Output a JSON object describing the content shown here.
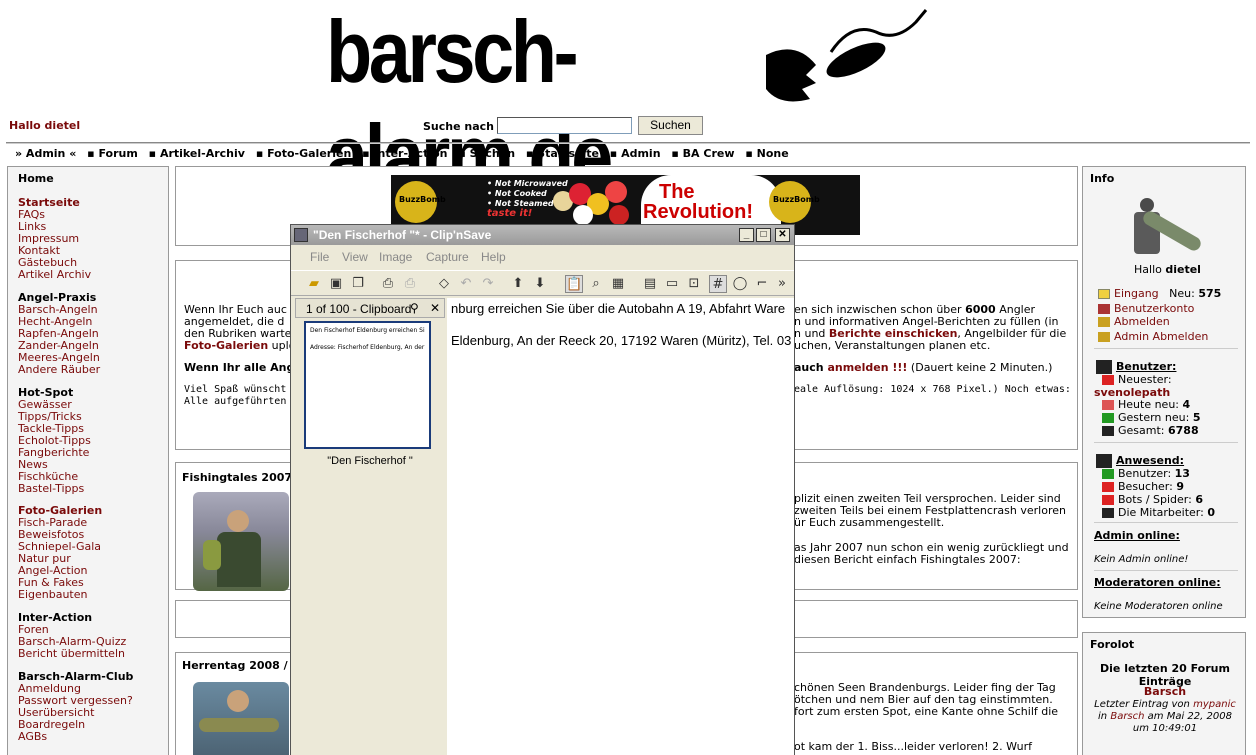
{
  "site": {
    "logo_text": "barsch-alarm.de",
    "greeting": "Hallo dietel"
  },
  "search": {
    "label": "Suche nach :",
    "value": "",
    "button": "Suchen"
  },
  "nav": [
    "» Admin «",
    "▪ Forum",
    "▪ Artikel-Archiv",
    "▪ Foto-Galerien",
    "▪ Inter-Action",
    "▪ Suchen",
    "▪ Startseite",
    "▪ Admin",
    "▪ BA Crew",
    "▪ None"
  ],
  "left": {
    "home": "Home",
    "groups": [
      {
        "items": [
          {
            "l": "Startseite",
            "b": true
          },
          {
            "l": "FAQs"
          },
          {
            "l": "Links"
          },
          {
            "l": "Impressum"
          },
          {
            "l": "Kontakt"
          },
          {
            "l": "Gästebuch"
          },
          {
            "l": "Artikel Archiv"
          }
        ]
      },
      {
        "header": "Angel-Praxis",
        "items": [
          {
            "l": "Barsch-Angeln"
          },
          {
            "l": "Hecht-Angeln"
          },
          {
            "l": "Rapfen-Angeln"
          },
          {
            "l": "Zander-Angeln"
          },
          {
            "l": "Meeres-Angeln"
          },
          {
            "l": "Andere Räuber"
          }
        ]
      },
      {
        "header": "Hot-Spot",
        "items": [
          {
            "l": "Gewässer"
          },
          {
            "l": "Tipps/Tricks"
          },
          {
            "l": "Tackle-Tipps"
          },
          {
            "l": "Echolot-Tipps"
          },
          {
            "l": "Fangberichte"
          },
          {
            "l": "News"
          },
          {
            "l": "Fischküche"
          },
          {
            "l": "Bastel-Tipps"
          }
        ]
      },
      {
        "items": [
          {
            "l": "Foto-Galerien",
            "b": true
          },
          {
            "l": "Fisch-Parade"
          },
          {
            "l": "Beweisfotos"
          },
          {
            "l": "Schniepel-Gala"
          },
          {
            "l": "Natur pur"
          },
          {
            "l": "Angel-Action"
          },
          {
            "l": "Fun & Fakes"
          },
          {
            "l": "Eigenbauten"
          }
        ]
      },
      {
        "header": "Inter-Action",
        "items": [
          {
            "l": "Foren"
          },
          {
            "l": "Barsch-Alarm-Quizz"
          },
          {
            "l": "Bericht übermitteln"
          }
        ]
      },
      {
        "header": "Barsch-Alarm-Club",
        "items": [
          {
            "l": "Anmeldung"
          },
          {
            "l": "Passwort vergessen?"
          },
          {
            "l": "Userübersicht"
          },
          {
            "l": "Boardregeln"
          },
          {
            "l": "AGBs"
          }
        ]
      }
    ]
  },
  "banner": {
    "lines": [
      "• Not Microwaved",
      "• Not Cooked",
      "• Not Steamed",
      "taste it!"
    ],
    "headline1": "The",
    "headline2": "Revolution!",
    "brand": "BuzzBomb"
  },
  "main1": {
    "l1a": "Wenn Ihr Euch auc",
    "l1b": "en sich inzwischen schon über ",
    "l1bold": "6000",
    "l1c": " Angler",
    "l2a": "angemeldet, die d",
    "l2b": "n und informativen Angel-Berichten zu füllen (in",
    "l3a": "den Rubriken warte",
    "l3b": "n und ",
    "l3link": "Berichte einschicken",
    "l3c": ", Angelbilder für die",
    "l4a": "Foto-Galerien",
    "l4b": " uplo",
    "l4c": "uchen, Veranstaltungen planen etc.",
    "l5a": "Wenn Ihr alle Ang",
    "l5b": "auch ",
    "l5link": "anmelden !!!",
    "l5c": " (Dauert keine 2 Minuten.)",
    "l6a": "Viel Spaß wünscht E",
    "l6b": "eale Auflösung: 1024 x 768 Pixel.) Noch etwas:",
    "l7a": "Alle aufgeführten P"
  },
  "main2": {
    "title": "Fishingtales 2007",
    "l1": "plizit einen zweiten Teil versprochen. Leider sind",
    "l2": "zweiten Teils bei einem Festplattencrash verloren",
    "l3": "ür Euch zusammengestellt.",
    "l4": "as Jahr 2007 nun schon ein wenig zurückliegt und",
    "l5": "diesen Bericht einfach Fishingtales 2007:"
  },
  "main4": {
    "title": "Herrentag 2008 / 1",
    "l1": "chönen Seen Brandenburgs. Leider fing der Tag",
    "l2": "ötchen und nem Bier auf den tag einstimmten.",
    "l3": "fort zum ersten Spot, eine Kante ohne Schilf die",
    "l4": "ot kam der 1. Biss...leider verloren! 2. Wurf"
  },
  "window": {
    "title": "\"Den Fischerhof \"* - Clip'nSave",
    "menu": [
      "File",
      "View",
      "Image",
      "Capture",
      "Help"
    ],
    "pane_title": "1 of 100 - Clipboard",
    "thumb_l1": "Den Fischerhof Eldenburg erreichen Si",
    "thumb_l2": "Adresse: Fischerhof Eldenburg, An der",
    "thumb_caption": "\"Den Fischerhof \"",
    "canvas_l1": "nburg erreichen Sie über die Autobahn A 19, Abfahrt Ware",
    "canvas_l2": "Eldenburg, An der Reeck 20, 17192 Waren (Müritz), Tel. 03"
  },
  "right": {
    "info": "Info",
    "hallo": "Hallo",
    "user": "dietel",
    "eingang": "Eingang",
    "neu": "Neu:",
    "neu_count": "575",
    "konto": "Benutzerkonto",
    "abmelden": "Abmelden",
    "admin_abmelden": "Admin Abmelden",
    "benutzer": "Benutzer:",
    "neuester": "Neuester:",
    "newest_user": "svenolepath",
    "heute": "Heute neu:",
    "heute_v": "4",
    "gestern": "Gestern neu:",
    "gestern_v": "5",
    "gesamt": "Gesamt:",
    "gesamt_v": "6788",
    "anwesend": "Anwesend:",
    "a_benutzer": "Benutzer:",
    "a_benutzer_v": "13",
    "besucher": "Besucher:",
    "besucher_v": "9",
    "bots": "Bots / Spider:",
    "bots_v": "6",
    "mitarbeiter": "Die Mitarbeiter:",
    "mitarbeiter_v": "0",
    "admin_online": "Admin online:",
    "kein_admin": "Kein Admin online!",
    "mod_online": "Moderatoren online:",
    "keine_mod": "Keine Moderatoren online",
    "forolot": "Forolot",
    "forum_hd": "Die letzten 20 Forum Einträge",
    "forum_topic": "Barsch",
    "last_a": "Letzter Eintrag von",
    "last_user": "mypanic",
    "last_b": "in",
    "last_forum": "Barsch",
    "last_c": "am Mai 22, 2008",
    "last_d": "um 10:49:01"
  }
}
